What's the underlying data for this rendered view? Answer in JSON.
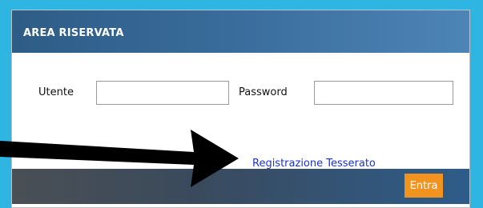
{
  "panel": {
    "title": "AREA RISERVATA"
  },
  "form": {
    "user_label": "Utente",
    "user_value": "",
    "password_label": "Password",
    "password_value": ""
  },
  "links": {
    "registration": "Registrazione Tesserato"
  },
  "footer": {
    "submit_label": "Entra"
  },
  "colors": {
    "background": "#2fb5e2",
    "header": "#3a6d9c",
    "link": "#1a33cc",
    "submit": "#f2921f"
  },
  "overlay": {
    "arrow_icon": "arrow-pointing-right-icon"
  }
}
